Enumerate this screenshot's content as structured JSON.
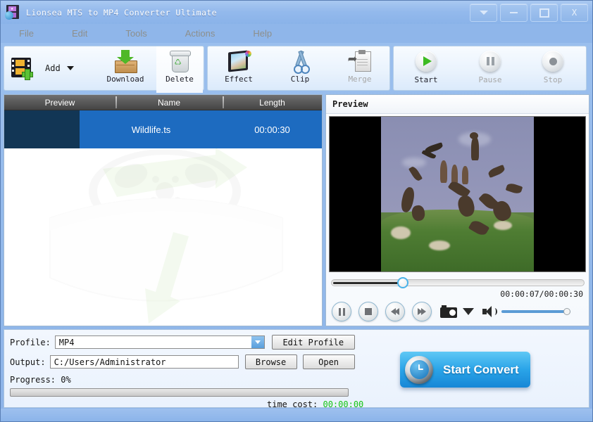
{
  "window": {
    "title": "Lionsea MTS to MP4 Converter Ultimate",
    "icon": "app-film-icon",
    "buttons": [
      {
        "name": "collapse",
        "glyph": "▼"
      },
      {
        "name": "minimize",
        "glyph": "—"
      },
      {
        "name": "maximize",
        "glyph": "▢"
      },
      {
        "name": "close",
        "glyph": "X"
      }
    ],
    "close_label": "X"
  },
  "menubar": {
    "items": [
      {
        "label": "File"
      },
      {
        "label": "Edit"
      },
      {
        "label": "Tools"
      },
      {
        "label": "Actions"
      },
      {
        "label": "Help"
      }
    ]
  },
  "toolbar": {
    "groups": [
      {
        "buttons": [
          {
            "label": "Add",
            "icon": "add-film-icon",
            "enabled": true,
            "has_dropdown": true
          },
          {
            "label": "Download",
            "icon": "download-box-icon",
            "enabled": true
          },
          {
            "label": "Delete",
            "icon": "recycle-bin-icon",
            "enabled": true
          }
        ]
      },
      {
        "buttons": [
          {
            "label": "Effect",
            "icon": "effect-filmstrip-icon",
            "enabled": true
          },
          {
            "label": "Clip",
            "icon": "scissors-icon",
            "enabled": true
          },
          {
            "label": "Merge",
            "icon": "merge-document-icon",
            "enabled": false
          }
        ]
      },
      {
        "buttons": [
          {
            "label": "Start",
            "icon": "play-icon",
            "enabled": true
          },
          {
            "label": "Pause",
            "icon": "pause-icon",
            "enabled": false
          },
          {
            "label": "Stop",
            "icon": "stop-icon",
            "enabled": false
          }
        ]
      }
    ]
  },
  "filelist": {
    "columns": [
      "Preview",
      "Name",
      "Length"
    ],
    "rows": [
      {
        "name": "Wildlife.ts",
        "length": "00:00:30",
        "selected": true
      }
    ],
    "selected_row_color": "#1d6bc0",
    "header_color": "#555555"
  },
  "preview": {
    "title": "Preview",
    "video": {
      "description": "birds-flying-over-grass",
      "letterboxed": true
    },
    "seek": {
      "position_percent": 23
    },
    "timecode": "00:00:07/00:00:30",
    "controls": [
      {
        "name": "pause-button",
        "icon": "pause-icon"
      },
      {
        "name": "stop-button",
        "icon": "stop-icon"
      },
      {
        "name": "rewind-button",
        "icon": "rewind-icon"
      },
      {
        "name": "forward-button",
        "icon": "fast-forward-icon"
      },
      {
        "name": "snapshot-button",
        "icon": "camera-icon"
      },
      {
        "name": "snapshot-menu",
        "icon": "chevron-down-icon"
      },
      {
        "name": "volume",
        "icon": "speaker-icon"
      }
    ],
    "volume_percent": 100
  },
  "settings": {
    "profile_label": "Profile:",
    "profile_value": "MP4",
    "profile_options": [
      "MP4"
    ],
    "edit_profile_label": "Edit Profile",
    "output_label": "Output:",
    "output_value": "C:/Users/Administrator",
    "browse_label": "Browse",
    "open_label": "Open",
    "progress_label": "Progress: 0%",
    "progress_percent": 0,
    "time_cost_label": "time cost:",
    "time_cost_value": "00:00:00",
    "time_cost_color": "#14c414"
  },
  "convert": {
    "label": "Start Convert",
    "icon": "clock-convert-icon",
    "accent": "#2aa4e8"
  }
}
